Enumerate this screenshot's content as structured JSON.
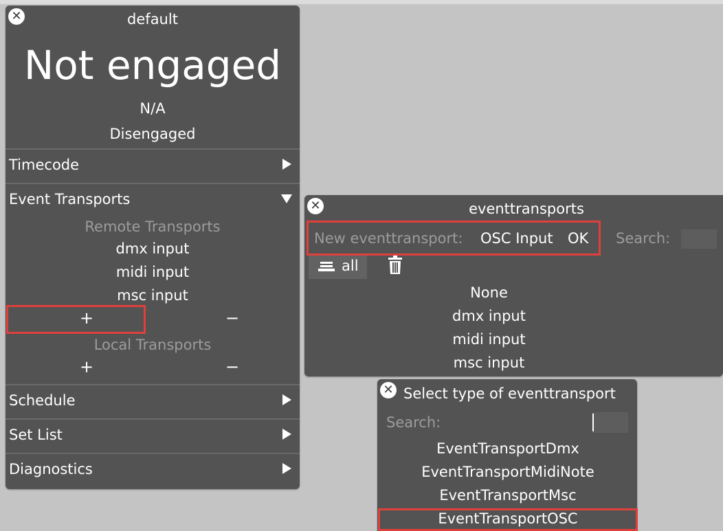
{
  "main_panel": {
    "title": "default",
    "status_big": "Not engaged",
    "status_sub": "N/A",
    "status_state": "Disengaged",
    "sections": {
      "timecode": "Timecode",
      "event_transports": "Event Transports",
      "schedule": "Schedule",
      "set_list": "Set List",
      "diagnostics": "Diagnostics"
    },
    "remote_transports": {
      "heading": "Remote Transports",
      "items": [
        "dmx input",
        "midi input",
        "msc input"
      ],
      "add": "+",
      "remove": "−"
    },
    "local_transports": {
      "heading": "Local Transports",
      "add": "+",
      "remove": "−"
    }
  },
  "eventtransports_panel": {
    "title": "eventtransports",
    "new_label": "New eventtransport:",
    "new_type": "OSC Input",
    "ok": "OK",
    "search_label": "Search:",
    "all_label": "all",
    "items": [
      "None",
      "dmx input",
      "midi input",
      "msc input"
    ]
  },
  "select_panel": {
    "title": "Select type of eventtransport",
    "search_label": "Search:",
    "options": [
      "EventTransportDmx",
      "EventTransportMidiNote",
      "EventTransportMsc",
      "EventTransportOSC"
    ]
  },
  "icons": {
    "close": "close-icon",
    "expand": "triangle-right-icon",
    "collapse": "triangle-down-icon",
    "list": "list-icon",
    "trash": "trash-icon"
  },
  "colors": {
    "background": "#c4c4c4",
    "panel": "#535353",
    "highlight": "#e0403c",
    "dim_text": "#9c9c9c"
  }
}
